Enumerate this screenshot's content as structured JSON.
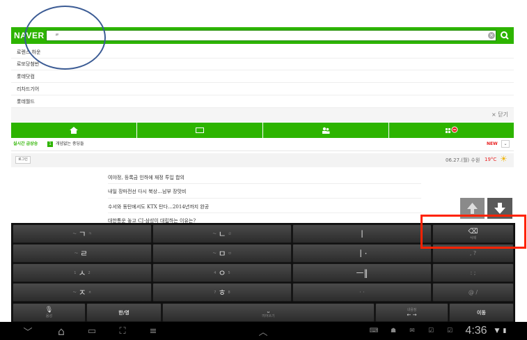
{
  "naver": {
    "logo": "NAVER",
    "search_value": "ㄹ",
    "clear_label": "×",
    "search_label": "Q"
  },
  "suggestions": [
    "로렌스 하운",
    "로또당첨번",
    "롯데닷컴",
    "리차드기어",
    "롯데월드"
  ],
  "close_label": "× 닫기",
  "realtime": {
    "label": "실시간 급상승",
    "rank": "1",
    "item": "개념없는 중딩들",
    "new_label": "NEW"
  },
  "info": {
    "login_label": "로그인",
    "weather": "06.27.(월) 수원",
    "temp": "19°C"
  },
  "news": [
    "여야정, 등록금 인하에 재정 투입 합의",
    "내일 장마전선 다시 북상…남부 장맛비",
    "수서와 동탄에서도 KTX 탄다…2014년까지 완공",
    "대한통운 놓고 CJ·삼성이 대립하는 이유는?"
  ],
  "keyboard": {
    "rows": [
      [
        {
          "main": "ㄱ",
          "left": "〜",
          "right": "ㅋ"
        },
        {
          "main": "ㄴ",
          "left": "〜",
          "right": "ㄹ"
        },
        {
          "main": "ㅣ",
          "left": "",
          "right": ""
        },
        {
          "main": "⌫",
          "left": "",
          "right": "삭제"
        }
      ],
      [
        {
          "main": "ㄹ",
          "left": "〜",
          "right": ""
        },
        {
          "main": "ㅁ",
          "left": "〜",
          "right": "ㅂ"
        },
        {
          "main": "ㅣ·",
          "left": "",
          "right": ""
        },
        {
          "main": ", ?",
          "left": "",
          "right": ""
        }
      ],
      [
        {
          "main": "ㅅ",
          "left": "1",
          "right": "2"
        },
        {
          "main": "ㅇ",
          "left": "4",
          "right": "5"
        },
        {
          "main": "ㅡ‖",
          "left": "",
          "right": ""
        },
        {
          "main": ": ;",
          "left": "",
          "right": ""
        }
      ],
      [
        {
          "main": "ㅈ",
          "left": "〜",
          "right": "ㅊ"
        },
        {
          "main": "ㅎ",
          "left": "7",
          "right": "8"
        },
        {
          "main": "· ·",
          "left": "",
          "right": ""
        },
        {
          "main": "@ /",
          "left": "",
          "right": ""
        }
      ]
    ],
    "func": {
      "mic_sub": "음성",
      "lang": "한/영",
      "space_sub": "띄어쓰기",
      "cursor_top": "내용정",
      "cursor_arrows": "← →",
      "move": "이동"
    }
  },
  "navbar": {
    "back": "﹀",
    "home": "⌂",
    "recent": "▭",
    "screenshot": "⛶",
    "menu": "≡",
    "up": "︿",
    "time": "4:36"
  },
  "colors": {
    "naver_green": "#2db400",
    "annotation_blue": "#3b5b94",
    "annotation_red": "#ff2200",
    "keyboard_bg": "#0f0f0f"
  }
}
